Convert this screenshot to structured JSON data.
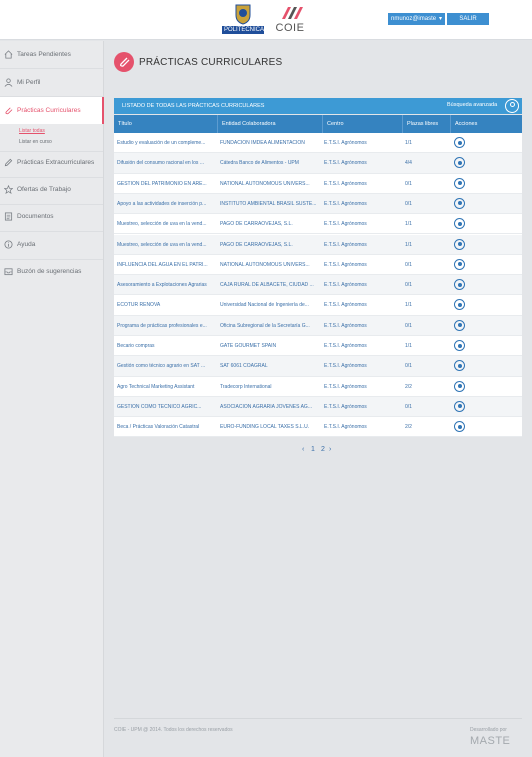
{
  "header": {
    "upm_logo_label": "POLITÉCNICA",
    "coie_logo_label": "COIE",
    "user_menu": "nmunoz@imaste",
    "logout_label": "SALIR"
  },
  "sidebar": {
    "items": [
      {
        "label": "Tareas Pendientes",
        "icon": "home-icon"
      },
      {
        "label": "Mi Perfil",
        "icon": "user-icon"
      },
      {
        "label": "Prácticas Curriculares",
        "icon": "paperclip-icon"
      },
      {
        "label": "Prácticas Extracurriculares",
        "icon": "pencil-icon"
      },
      {
        "label": "Ofertas de Trabajo",
        "icon": "star-icon"
      },
      {
        "label": "Documentos",
        "icon": "document-icon"
      },
      {
        "label": "Ayuda",
        "icon": "info-icon"
      },
      {
        "label": "Buzón de sugerencias",
        "icon": "inbox-icon"
      }
    ],
    "sub_items": [
      {
        "label": "Listar todas"
      },
      {
        "label": "Listar en curso"
      }
    ]
  },
  "page": {
    "title": "PRÁCTICAS CURRICULARES",
    "icon": "paperclip-icon"
  },
  "panel": {
    "title": "LISTADO DE TODAS LAS PRÁCTICAS CURRICULARES",
    "advanced_search_label": "Búsqueda avanzada",
    "columns": [
      "Título",
      "Entidad Colaboradora",
      "Centro",
      "Plazas libres",
      "Acciones"
    ],
    "rows": [
      {
        "title": "Estudio y evaluación de un compleme...",
        "entity": "FUNDACIÓN IMDEA ALIMENTACIÓN",
        "center": "E.T.S.I. Agrónomos",
        "slots": "1/1"
      },
      {
        "title": "Difusión del consumo racional en los ...",
        "entity": "Cátedra Banco de Alimentos - UPM",
        "center": "E.T.S.I. Agrónomos",
        "slots": "4/4"
      },
      {
        "title": "GESTION DEL PATRIMONIO EN ARE...",
        "entity": "NATIONAL AUTONOMOUS UNIVERS...",
        "center": "E.T.S.I. Agrónomos",
        "slots": "0/1"
      },
      {
        "title": "Apoyo a las actividades de inserción p...",
        "entity": "INSTITUTO AMBIENTAL BRASIL SUSTE...",
        "center": "E.T.S.I. Agrónomos",
        "slots": "0/1"
      },
      {
        "title": "Muestreo, selección de uva en la vend...",
        "entity": "PAGO DE CARRAOVEJAS, S.L.",
        "center": "E.T.S.I. Agrónomos",
        "slots": "1/1"
      },
      {
        "title": "Muestreo, selección de uva en la vend...",
        "entity": "PAGO DE CARRAOVEJAS, S.L.",
        "center": "E.T.S.I. Agrónomos",
        "slots": "1/1"
      },
      {
        "title": "INFLUENCIA DEL AGUA EN EL PATRI...",
        "entity": "NATIONAL AUTONOMOUS UNIVERS...",
        "center": "E.T.S.I. Agrónomos",
        "slots": "0/1"
      },
      {
        "title": "Asesoramiento a Explotaciones Agrarias",
        "entity": "CAJA RURAL DE ALBACETE, CIUDAD ...",
        "center": "E.T.S.I. Agrónomos",
        "slots": "0/1"
      },
      {
        "title": "ECOTUR RENOVA",
        "entity": "Universidad Nacional de Ingeniería de...",
        "center": "E.T.S.I. Agrónomos",
        "slots": "1/1"
      },
      {
        "title": "Programa de prácticas profesionales e...",
        "entity": "Oficina Subregional de la Secretaría G...",
        "center": "E.T.S.I. Agrónomos",
        "slots": "0/1"
      },
      {
        "title": "Becario compras",
        "entity": "GATE GOURMET SPAIN",
        "center": "E.T.S.I. Agrónomos",
        "slots": "1/1"
      },
      {
        "title": "Gestión como técnico agrario en SAT ...",
        "entity": "SAT 6061 COAGRAL",
        "center": "E.T.S.I. Agrónomos",
        "slots": "0/1"
      },
      {
        "title": "Agro Technical Marketing Assistant",
        "entity": "Tradecorp International",
        "center": "E.T.S.I. Agrónomos",
        "slots": "2/2"
      },
      {
        "title": "GESTION COMO TECNICO AGRIC...",
        "entity": "ASOCIACION AGRARIA JOVENES AG...",
        "center": "E.T.S.I. Agrónomos",
        "slots": "0/1"
      },
      {
        "title": "Beca / Prácticas Valoración Catastral",
        "entity": "EURO-FUNDING LOCAL TAXES S.L.U.",
        "center": "E.T.S.I. Agrónomos",
        "slots": "2/2"
      }
    ]
  },
  "pagination": {
    "prev": "‹",
    "pages": [
      "1",
      "2"
    ],
    "next": "›"
  },
  "footer": {
    "copyright": "COIE - UPM @ 2014. Todos los derechos reservados",
    "developed_by": "Desarrollado por",
    "brand": "MASTE"
  },
  "colors": {
    "accent": "#e5526c",
    "panel_header": "#3d9ad5",
    "table_header": "#3583c0",
    "link": "#3a6fa8"
  }
}
